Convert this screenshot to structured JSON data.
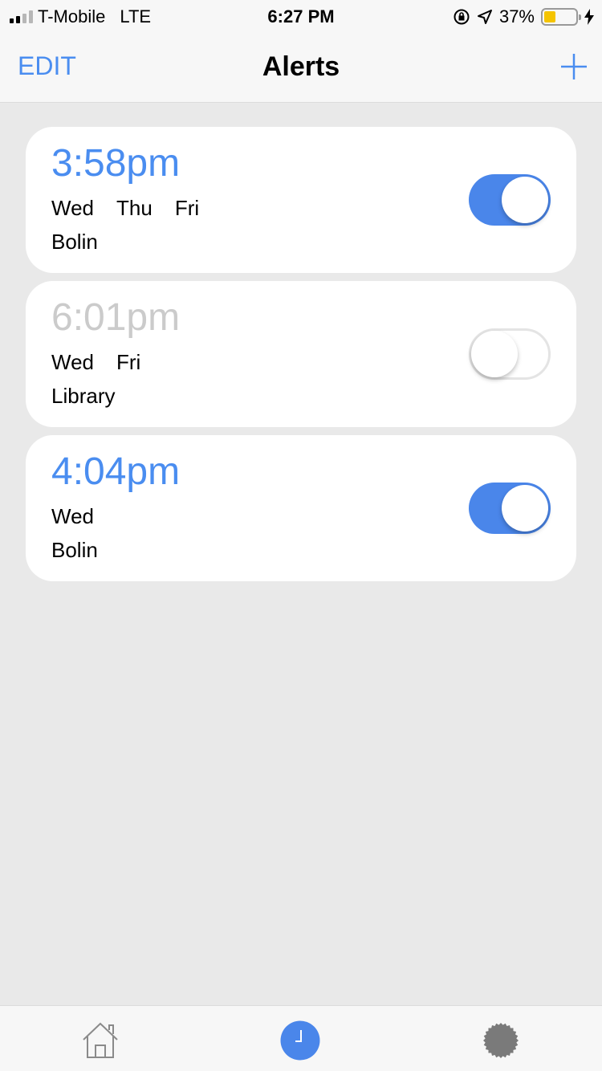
{
  "status_bar": {
    "carrier": "T-Mobile",
    "network": "LTE",
    "time": "6:27 PM",
    "battery_percent": "37%",
    "battery_level": 0.37
  },
  "nav": {
    "edit_label": "EDIT",
    "title": "Alerts",
    "add_icon": "plus-icon"
  },
  "alerts": [
    {
      "time": "3:58pm",
      "days": [
        "Wed",
        "Thu",
        "Fri"
      ],
      "location": "Bolin",
      "enabled": true
    },
    {
      "time": "6:01pm",
      "days": [
        "Wed",
        "Fri"
      ],
      "location": "Library",
      "enabled": false
    },
    {
      "time": "4:04pm",
      "days": [
        "Wed"
      ],
      "location": "Bolin",
      "enabled": true
    }
  ],
  "tab_bar": {
    "tabs": [
      {
        "icon": "home-icon",
        "active": false
      },
      {
        "icon": "clock-icon",
        "active": true
      },
      {
        "icon": "gear-icon",
        "active": false
      }
    ]
  },
  "colors": {
    "accent": "#4a8df0",
    "toggle_on": "#4a86ea",
    "inactive_time": "#cbcbcb",
    "battery": "#f5c400"
  }
}
